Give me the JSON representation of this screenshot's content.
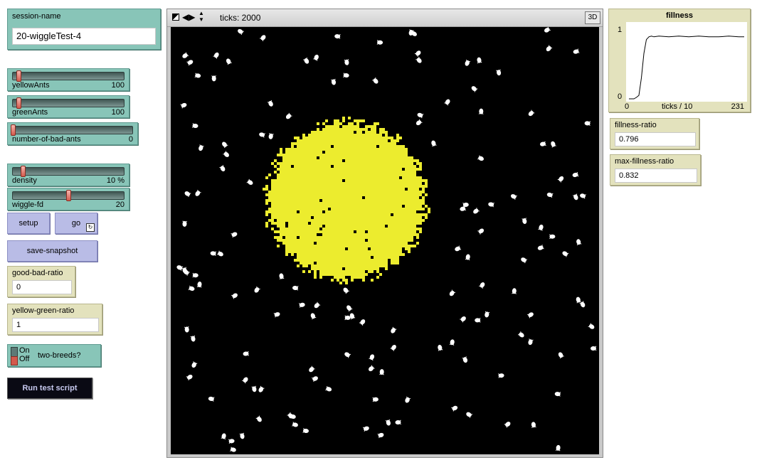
{
  "session": {
    "label": "session-name",
    "value": "20-wiggleTest-4"
  },
  "sliders": [
    {
      "id": "yellowAnts",
      "label": "yellowAnts",
      "value": "100",
      "fraction": 0.05
    },
    {
      "id": "greenAnts",
      "label": "greenAnts",
      "value": "100",
      "fraction": 0.05
    },
    {
      "id": "number-of-bad-ants",
      "label": "number-of-bad-ants",
      "value": "0",
      "fraction": 0.0
    },
    {
      "id": "density",
      "label": "density",
      "value": "10 %",
      "fraction": 0.1
    },
    {
      "id": "wiggle-fd",
      "label": "wiggle-fd",
      "value": "20",
      "fraction": 0.5
    }
  ],
  "buttons": {
    "setup": "setup",
    "go": "go",
    "save_snapshot": "save-snapshot",
    "run_test": "Run test script"
  },
  "monitors": {
    "good_bad": {
      "label": "good-bad-ratio",
      "value": "0"
    },
    "yellow_green": {
      "label": "yellow-green-ratio",
      "value": "1"
    },
    "fillness_ratio": {
      "label": "fillness-ratio",
      "value": "0.796"
    },
    "max_fillness_ratio": {
      "label": "max-fillness-ratio",
      "value": "0.832"
    }
  },
  "switch": {
    "label": "two-breeds?",
    "on": "On",
    "off": "Off",
    "state": "off"
  },
  "view": {
    "ticks_label": "ticks: 2000",
    "three_d": "3D"
  },
  "plot": {
    "title": "fillness",
    "y_max": "1",
    "y_min": "0",
    "x_min": "0",
    "x_max": "231",
    "x_label": "ticks / 10"
  },
  "chart_data": {
    "type": "line",
    "title": "fillness",
    "xlabel": "ticks / 10",
    "ylabel": "",
    "xlim": [
      0,
      231
    ],
    "ylim": [
      0,
      1
    ],
    "x": [
      0,
      10,
      15,
      20,
      25,
      30,
      35,
      40,
      45,
      50,
      60,
      80,
      100,
      120,
      140,
      160,
      180,
      200,
      220,
      231
    ],
    "y": [
      0,
      0,
      0.02,
      0.05,
      0.3,
      0.65,
      0.85,
      0.89,
      0.9,
      0.89,
      0.9,
      0.89,
      0.9,
      0.89,
      0.9,
      0.89,
      0.89,
      0.9,
      0.89,
      0.89
    ]
  },
  "colors": {
    "teal": "#88c5b8",
    "khaki": "#e3e2bd",
    "lavender": "#b9bce6",
    "patch": "#ecec2e",
    "ant": "#ffffff",
    "world": "#000000"
  }
}
